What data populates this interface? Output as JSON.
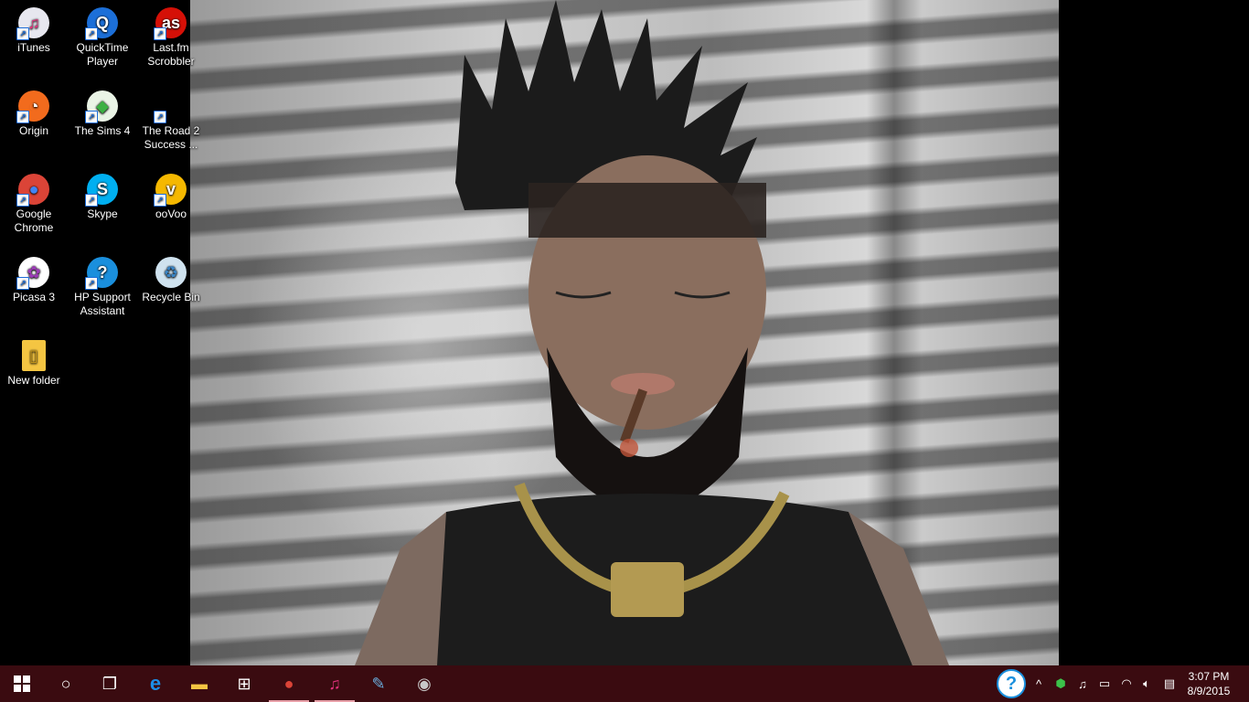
{
  "desktop": {
    "icons": [
      {
        "id": "itunes",
        "label": "iTunes",
        "icon": "itunes-icon",
        "color": "#e7e7ef",
        "glyph": "♫",
        "glyph_color": "#e0307a"
      },
      {
        "id": "quicktime",
        "label": "QuickTime Player",
        "icon": "quicktime-icon",
        "color": "#1c6fd8",
        "glyph": "Q",
        "glyph_color": "#ffffff"
      },
      {
        "id": "lastfm",
        "label": "Last.fm Scrobbler",
        "icon": "lastfm-icon",
        "color": "#d51007",
        "glyph": "as",
        "glyph_color": "#ffffff"
      },
      {
        "id": "origin",
        "label": "Origin",
        "icon": "origin-icon",
        "color": "#f26b1d",
        "glyph": "◔",
        "glyph_color": "#ffffff"
      },
      {
        "id": "sims4",
        "label": "The Sims 4",
        "icon": "sims-plumbob-icon",
        "color": "#eaf4e6",
        "glyph": "◆",
        "glyph_color": "#3cb043"
      },
      {
        "id": "road2success",
        "label": "The Road 2 Success ...",
        "icon": "shortcut-icon",
        "color": "transparent",
        "glyph": "",
        "glyph_color": "#ffffff"
      },
      {
        "id": "chrome",
        "label": "Google Chrome",
        "icon": "chrome-icon",
        "color": "#db4437",
        "glyph": "●",
        "glyph_color": "#4285f4"
      },
      {
        "id": "skype",
        "label": "Skype",
        "icon": "skype-icon",
        "color": "#00aff0",
        "glyph": "S",
        "glyph_color": "#ffffff"
      },
      {
        "id": "oovoo",
        "label": "ooVoo",
        "icon": "oovoo-icon",
        "color": "#f5b800",
        "glyph": "v",
        "glyph_color": "#ffffff"
      },
      {
        "id": "picasa",
        "label": "Picasa 3",
        "icon": "picasa-icon",
        "color": "#ffffff",
        "glyph": "✿",
        "glyph_color": "#9b3bb5"
      },
      {
        "id": "hpsupport",
        "label": "HP Support Assistant",
        "icon": "help-icon",
        "color": "#1a8fdd",
        "glyph": "?",
        "glyph_color": "#ffffff"
      },
      {
        "id": "recyclebin",
        "label": "Recycle Bin",
        "icon": "recycle-bin-icon",
        "color": "#cfe2ef",
        "glyph": "♻",
        "glyph_color": "#3a84c4"
      },
      {
        "id": "newfolder",
        "label": "New folder",
        "icon": "folder-icon",
        "color": "#f4c542",
        "glyph": "▯",
        "glyph_color": "#c99a1c"
      }
    ]
  },
  "taskbar": {
    "start_icon": "windows-start-icon",
    "apps": [
      {
        "id": "search",
        "icon": "cortana-circle-icon",
        "glyph": "○"
      },
      {
        "id": "taskview",
        "icon": "task-view-icon",
        "glyph": "❐"
      },
      {
        "id": "edge",
        "icon": "edge-icon",
        "glyph": "e",
        "color": "#1c8ee8"
      },
      {
        "id": "explorer",
        "icon": "file-explorer-icon",
        "glyph": "▬",
        "color": "#f4c542"
      },
      {
        "id": "store",
        "icon": "store-icon",
        "glyph": "⊞",
        "color": "#ffffff"
      },
      {
        "id": "chrome",
        "icon": "chrome-icon",
        "glyph": "●",
        "color": "#db4437"
      },
      {
        "id": "itunes",
        "icon": "itunes-icon",
        "glyph": "♫",
        "color": "#e0307a"
      },
      {
        "id": "notepad",
        "icon": "notepad-icon",
        "glyph": "✎",
        "color": "#6ab0e0"
      },
      {
        "id": "camera",
        "icon": "camera-icon",
        "glyph": "◉",
        "color": "#c8c8c8"
      }
    ],
    "tray": [
      {
        "id": "help",
        "icon": "help-tray-icon",
        "glyph": "?"
      },
      {
        "id": "chevron",
        "icon": "chevron-up-icon",
        "glyph": "^"
      },
      {
        "id": "shield",
        "icon": "shield-icon",
        "glyph": "⬢"
      },
      {
        "id": "itunes",
        "icon": "itunes-tray-icon",
        "glyph": "♫"
      },
      {
        "id": "battery",
        "icon": "battery-icon",
        "glyph": "▭"
      },
      {
        "id": "wifi",
        "icon": "wifi-icon",
        "glyph": "◠"
      },
      {
        "id": "volume",
        "icon": "volume-icon",
        "glyph": "🔈︎"
      },
      {
        "id": "notifications",
        "icon": "action-center-icon",
        "glyph": "▤"
      }
    ],
    "clock": {
      "time": "3:07 PM",
      "date": "8/9/2015"
    }
  }
}
